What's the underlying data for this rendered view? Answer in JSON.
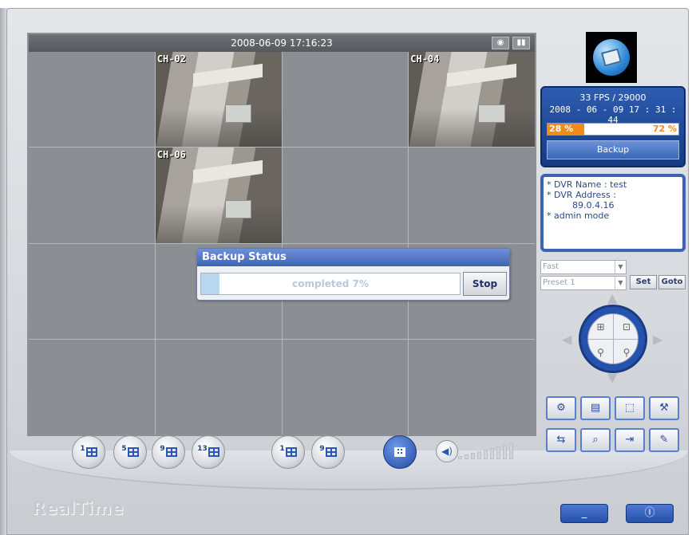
{
  "window": {
    "brand": "RealTime",
    "minimize_label": "_",
    "power_label": "Ⓘ"
  },
  "video": {
    "timestamp": "2008-06-09 17:16:23",
    "titlebar_icons": [
      "snapshot-icon",
      "record-icon"
    ],
    "cells": [
      {
        "label": "",
        "has_video": false
      },
      {
        "label": "CH-02",
        "has_video": true
      },
      {
        "label": "",
        "has_video": false
      },
      {
        "label": "CH-04",
        "has_video": true
      },
      {
        "label": "",
        "has_video": false
      },
      {
        "label": "CH-06",
        "has_video": true
      },
      {
        "label": "",
        "has_video": false
      },
      {
        "label": "",
        "has_video": false
      },
      {
        "label": "",
        "has_video": false
      },
      {
        "label": "",
        "has_video": false
      },
      {
        "label": "",
        "has_video": false
      },
      {
        "label": "",
        "has_video": false
      },
      {
        "label": "",
        "has_video": false
      },
      {
        "label": "",
        "has_video": false
      },
      {
        "label": "",
        "has_video": false
      },
      {
        "label": "",
        "has_video": false
      }
    ]
  },
  "backup_dialog": {
    "title": "Backup Status",
    "progress_text": "completed 7%",
    "progress_value": 7,
    "stop_label": "Stop"
  },
  "status": {
    "fps": "33 FPS / 29000",
    "datetime": "2008 - 06 - 09  17 : 31 : 44",
    "disk_used_label": "28 %",
    "disk_free_label": "72 %",
    "disk_used_value": 28,
    "backup_label": "Backup"
  },
  "info": {
    "line1": "* DVR Name : test",
    "line2": "* DVR Address :",
    "address": "89.0.4.16",
    "line3": "* admin mode"
  },
  "ptz": {
    "speed_value": "Fast",
    "preset_value": "Preset 1",
    "set_label": "Set",
    "goto_label": "Goto",
    "quadrant_icons": [
      "zoom-in-icon",
      "zoom-out-icon",
      "focus-near-icon",
      "focus-far-icon"
    ]
  },
  "action_buttons_row1": [
    "setup-icon",
    "playback-icon",
    "fullscreen-icon",
    "tools-icon"
  ],
  "action_buttons_row2": [
    "network-icon",
    "search-icon",
    "export-icon",
    "config-icon"
  ],
  "layout_buttons": [
    {
      "num": "1",
      "active": false
    },
    {
      "num": "5",
      "active": false
    },
    {
      "num": "9",
      "active": false
    },
    {
      "num": "13",
      "active": false
    },
    {
      "num": "1",
      "active": false
    },
    {
      "num": "9",
      "active": false
    },
    {
      "num": "",
      "active": true
    }
  ],
  "colors": {
    "accent": "#2d5cb0",
    "disk_used": "#f28b17"
  }
}
